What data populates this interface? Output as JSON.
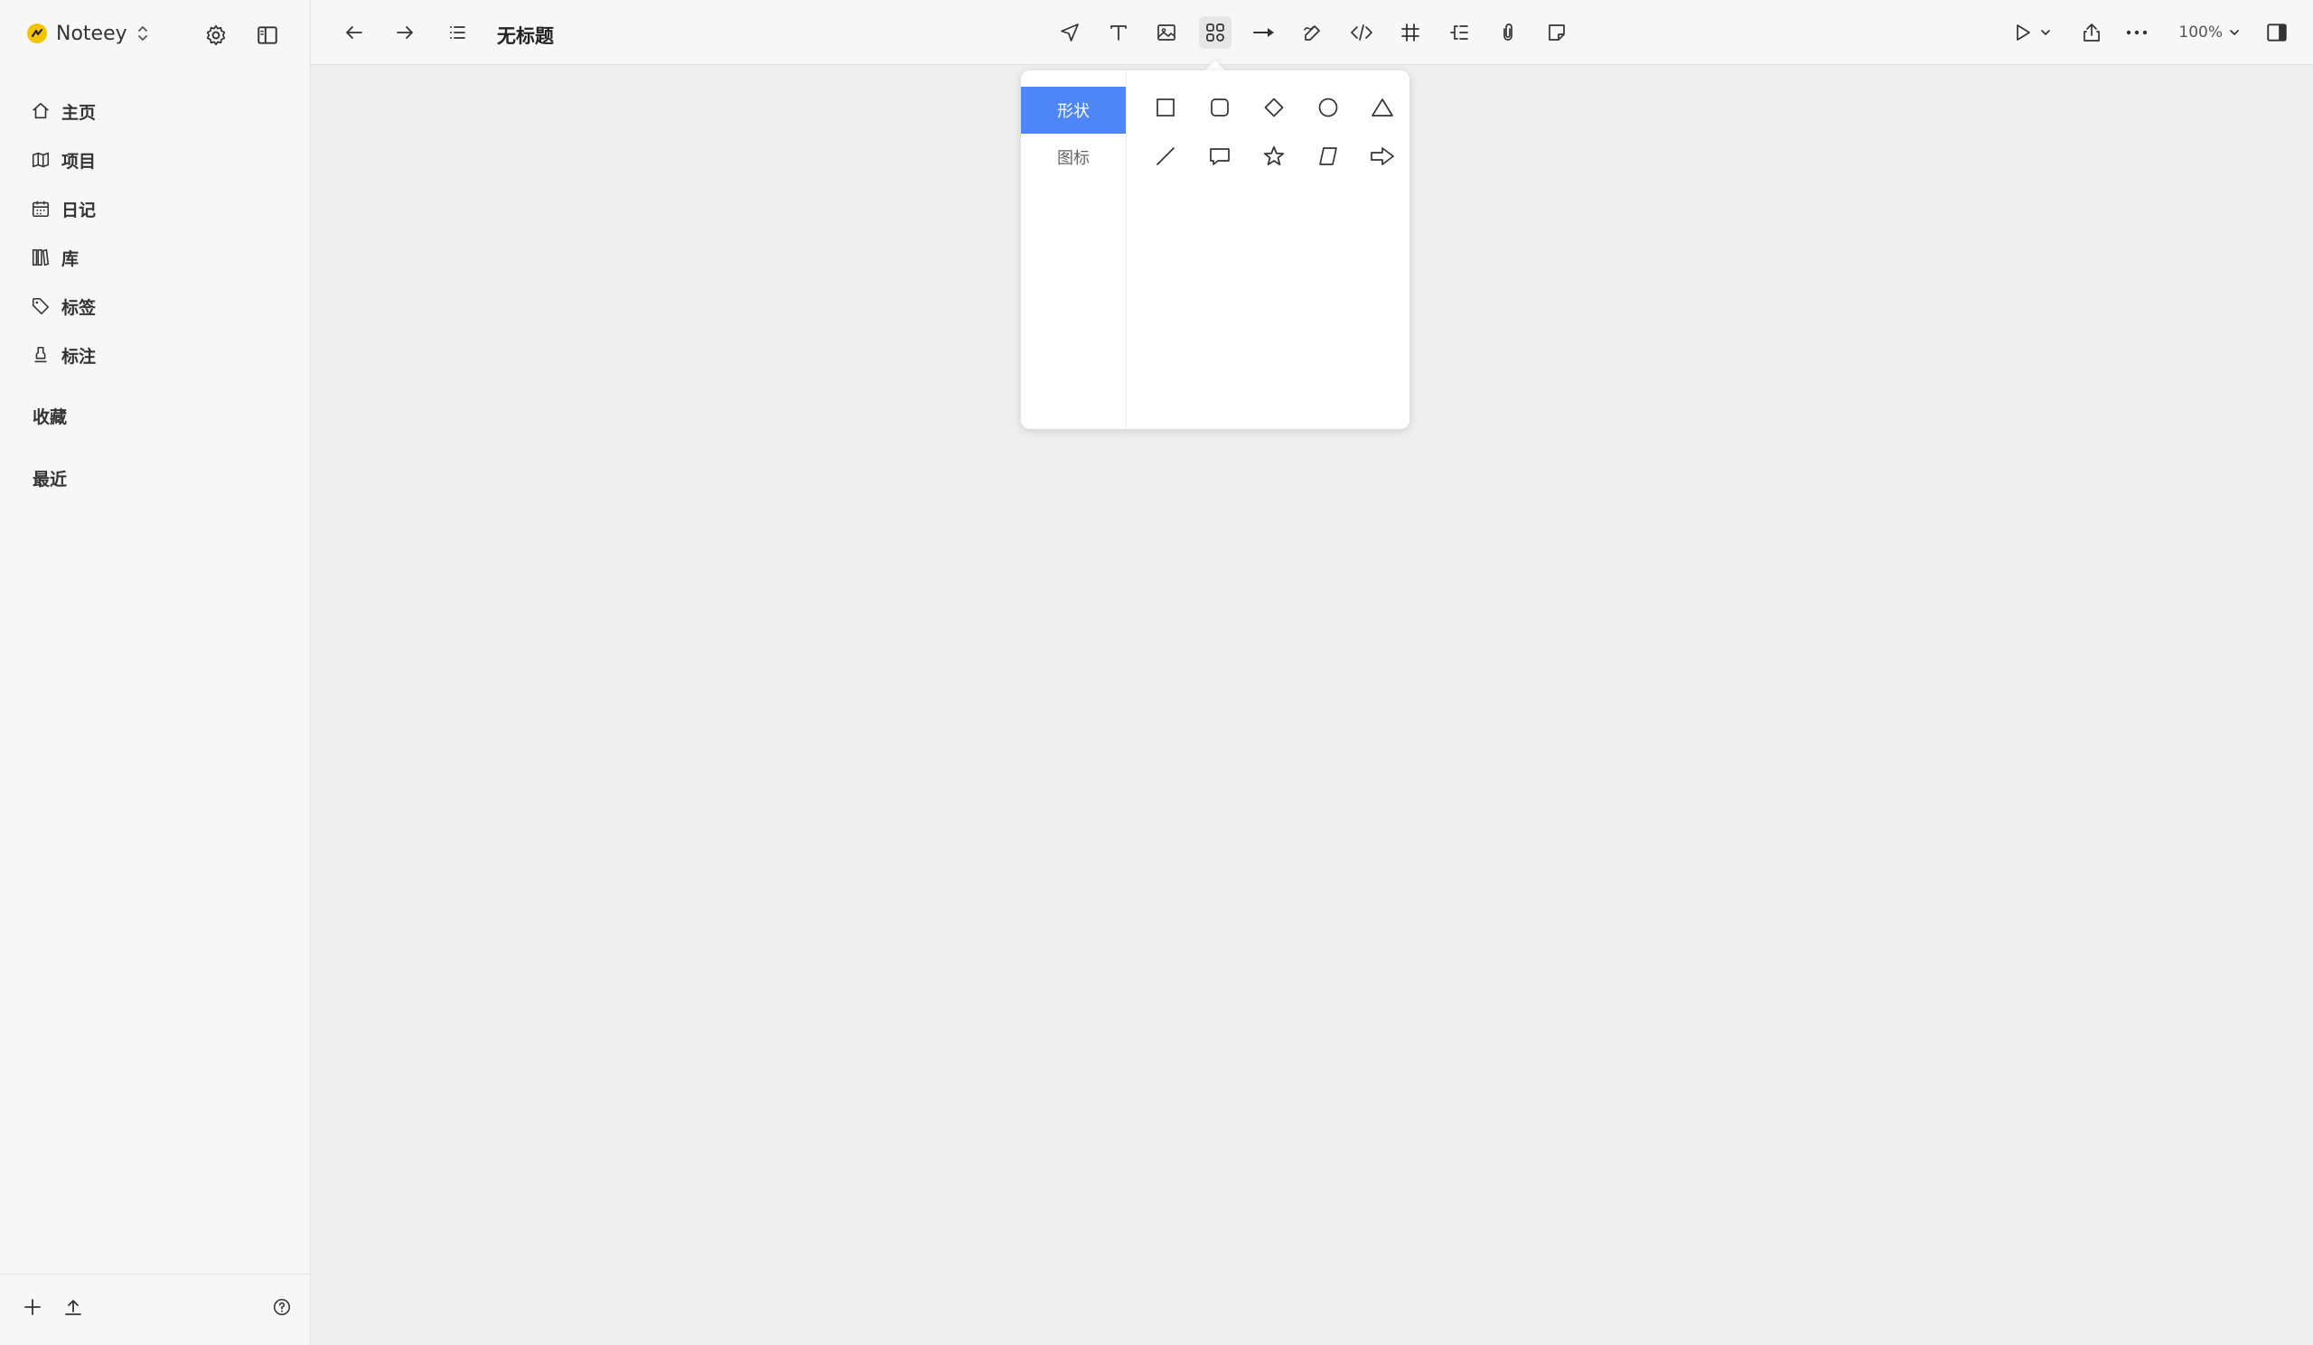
{
  "app": {
    "name": "Noteey"
  },
  "sidebar": {
    "nav_items": [
      {
        "label": "主页",
        "icon": "home-icon"
      },
      {
        "label": "项目",
        "icon": "map-icon"
      },
      {
        "label": "日记",
        "icon": "calendar-icon"
      },
      {
        "label": "库",
        "icon": "library-icon"
      },
      {
        "label": "标签",
        "icon": "tag-icon"
      },
      {
        "label": "标注",
        "icon": "highlighter-icon"
      }
    ],
    "sections": {
      "favorites": "收藏",
      "recent": "最近"
    }
  },
  "header": {
    "title": "无标题",
    "zoom": "100%",
    "tools": [
      "select-arrow-icon",
      "text-icon",
      "image-icon",
      "shapes-icon",
      "connector-arrow-icon",
      "pen-icon",
      "code-icon",
      "frame-icon",
      "mindmap-icon",
      "attachment-icon",
      "sticky-note-icon"
    ]
  },
  "shape_picker": {
    "tabs": [
      {
        "label": "形状",
        "active": true
      },
      {
        "label": "图标",
        "active": false
      }
    ],
    "shapes": [
      "rectangle",
      "rounded-rectangle",
      "diamond",
      "circle",
      "triangle",
      "line",
      "speech-bubble",
      "star",
      "parallelogram",
      "arrow"
    ]
  },
  "colors": {
    "accent": "#4f86f7",
    "logo": "#f5c400",
    "canvas": "#efefef",
    "sidebar": "#f7f7f7"
  }
}
